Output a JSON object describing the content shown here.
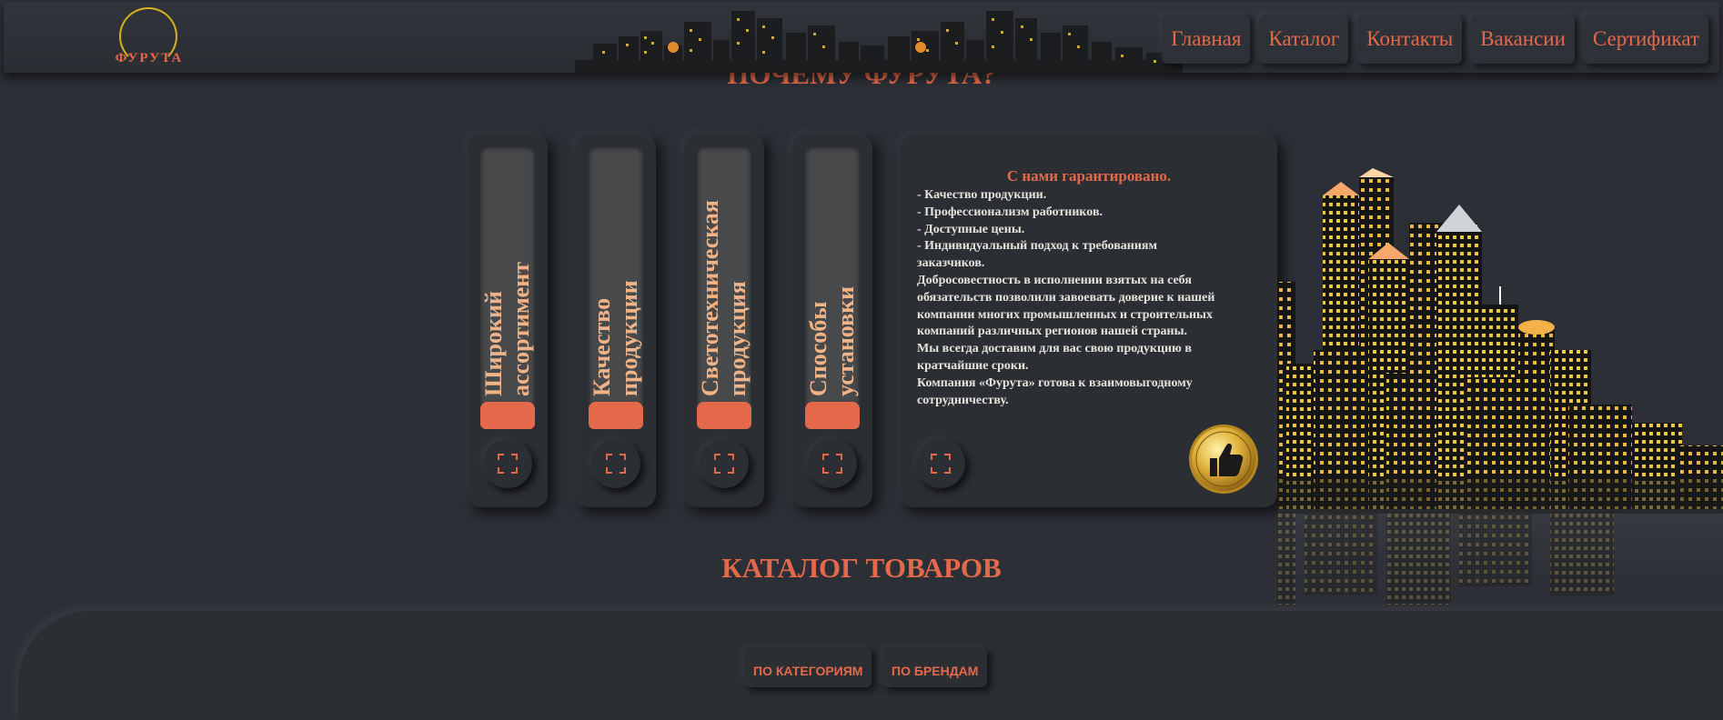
{
  "logo": {
    "text": "ФУРУТА"
  },
  "nav": {
    "items": [
      "Главная",
      "Каталог",
      "Контакты",
      "Вакансии",
      "Сертификат"
    ]
  },
  "why": {
    "title": "ПОЧЕМУ ФУРУТА?"
  },
  "cards": [
    {
      "lines": [
        "Широкий",
        "ассортимент"
      ]
    },
    {
      "lines": [
        "Качество",
        "продукции"
      ]
    },
    {
      "lines": [
        "Светотехническая",
        "продукция"
      ]
    },
    {
      "lines": [
        "Способы",
        "установки"
      ]
    }
  ],
  "info": {
    "title": "С нами гарантировано.",
    "lines": [
      "- Качество продукции.",
      "- Профессионализм работников.",
      "- Доступные цены.",
      "- Индивидуальный подход к требованиям",
      "заказчиков.",
      "Добросовестность в исполнении взятых на себя",
      "обязательств позволили завоевать доверие к нашей",
      "компании многих промышленных и строительных",
      "компаний различных регионов нашей страны.",
      "Мы всегда доставим для вас свою продукцию в",
      "кратчайшие сроки.",
      "Компания «Фурута» готова к взаимовыгодному",
      "сотрудничеству."
    ]
  },
  "catalog": {
    "title": "КАТАЛОГ ТОВАРОВ",
    "tabs": [
      "ПО КАТЕГОРИЯМ",
      "ПО БРЕНДАМ"
    ]
  },
  "colors": {
    "accent": "#e4694a",
    "background": "#2c2f35",
    "gold": "#d9b21f"
  },
  "icons": {
    "expand": "expand-icon",
    "thumb": "thumbs-up-icon"
  }
}
